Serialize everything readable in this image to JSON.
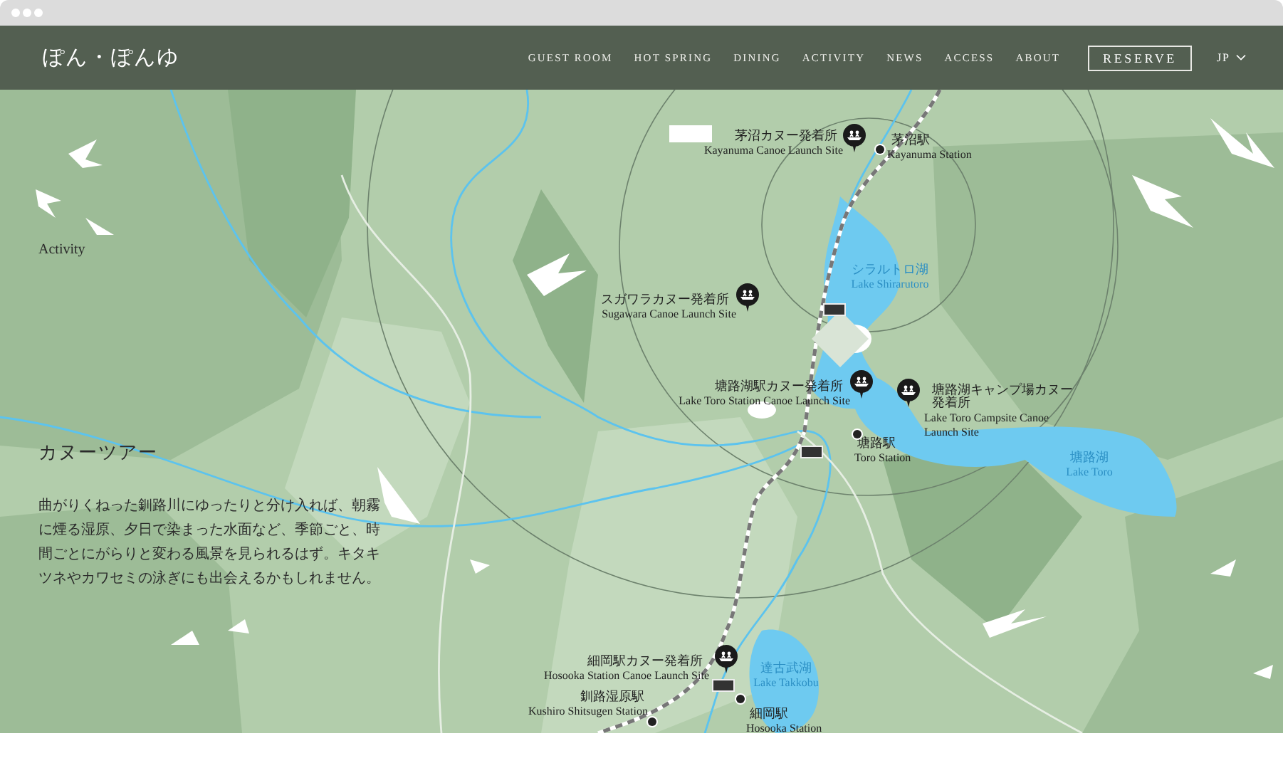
{
  "header": {
    "logo": "ぽん・ぽんゆ",
    "nav": [
      {
        "label": "GUEST ROOM"
      },
      {
        "label": "HOT SPRING"
      },
      {
        "label": "DINING"
      },
      {
        "label": "ACTIVITY"
      },
      {
        "label": "NEWS"
      },
      {
        "label": "ACCESS"
      },
      {
        "label": "ABOUT"
      }
    ],
    "reserve": "RESERVE",
    "language": "JP"
  },
  "intro": {
    "section": "Activity",
    "title": "カヌーツアー",
    "body": "曲がりくねった釧路川にゆったりと分け入れば、朝霧に煙る湿原、夕日で染まった水面など、季節ごと、時間ごとにがらりと変わる風景を見られるはず。キタキツネやカワセミの泳ぎにも出会えるかもしれません。"
  },
  "map": {
    "launch_sites": [
      {
        "name_ja": "茅沼カヌー発着所",
        "name_en": "Kayanuma Canoe Launch Site"
      },
      {
        "name_ja": "スガワラカヌー発着所",
        "name_en": "Sugawara Canoe Launch Site"
      },
      {
        "name_ja": "塘路湖駅カヌー発着所",
        "name_en": "Lake Toro Station Canoe Launch Site"
      },
      {
        "name_ja": "塘路湖キャンプ場カヌー発着所",
        "name_en": "Lake Toro Campsite Canoe Launch Site"
      },
      {
        "name_ja": "細岡駅カヌー発着所",
        "name_en": "Hosooka Station Canoe Launch Site"
      }
    ],
    "stations": [
      {
        "name_ja": "茅沼駅",
        "name_en": "Kayanuma Station"
      },
      {
        "name_ja": "塘路駅",
        "name_en": "Toro Station"
      },
      {
        "name_ja": "釧路湿原駅",
        "name_en": "Kushiro Shitsugen Station"
      },
      {
        "name_ja": "細岡駅",
        "name_en": "Hosooka Station"
      }
    ],
    "lakes": [
      {
        "name_ja": "シラルトロ湖",
        "name_en": "Lake Shirarutoro"
      },
      {
        "name_ja": "塘路湖",
        "name_en": "Lake Toro"
      },
      {
        "name_ja": "達古武湖",
        "name_en": "Lake Takkobu"
      }
    ]
  }
}
